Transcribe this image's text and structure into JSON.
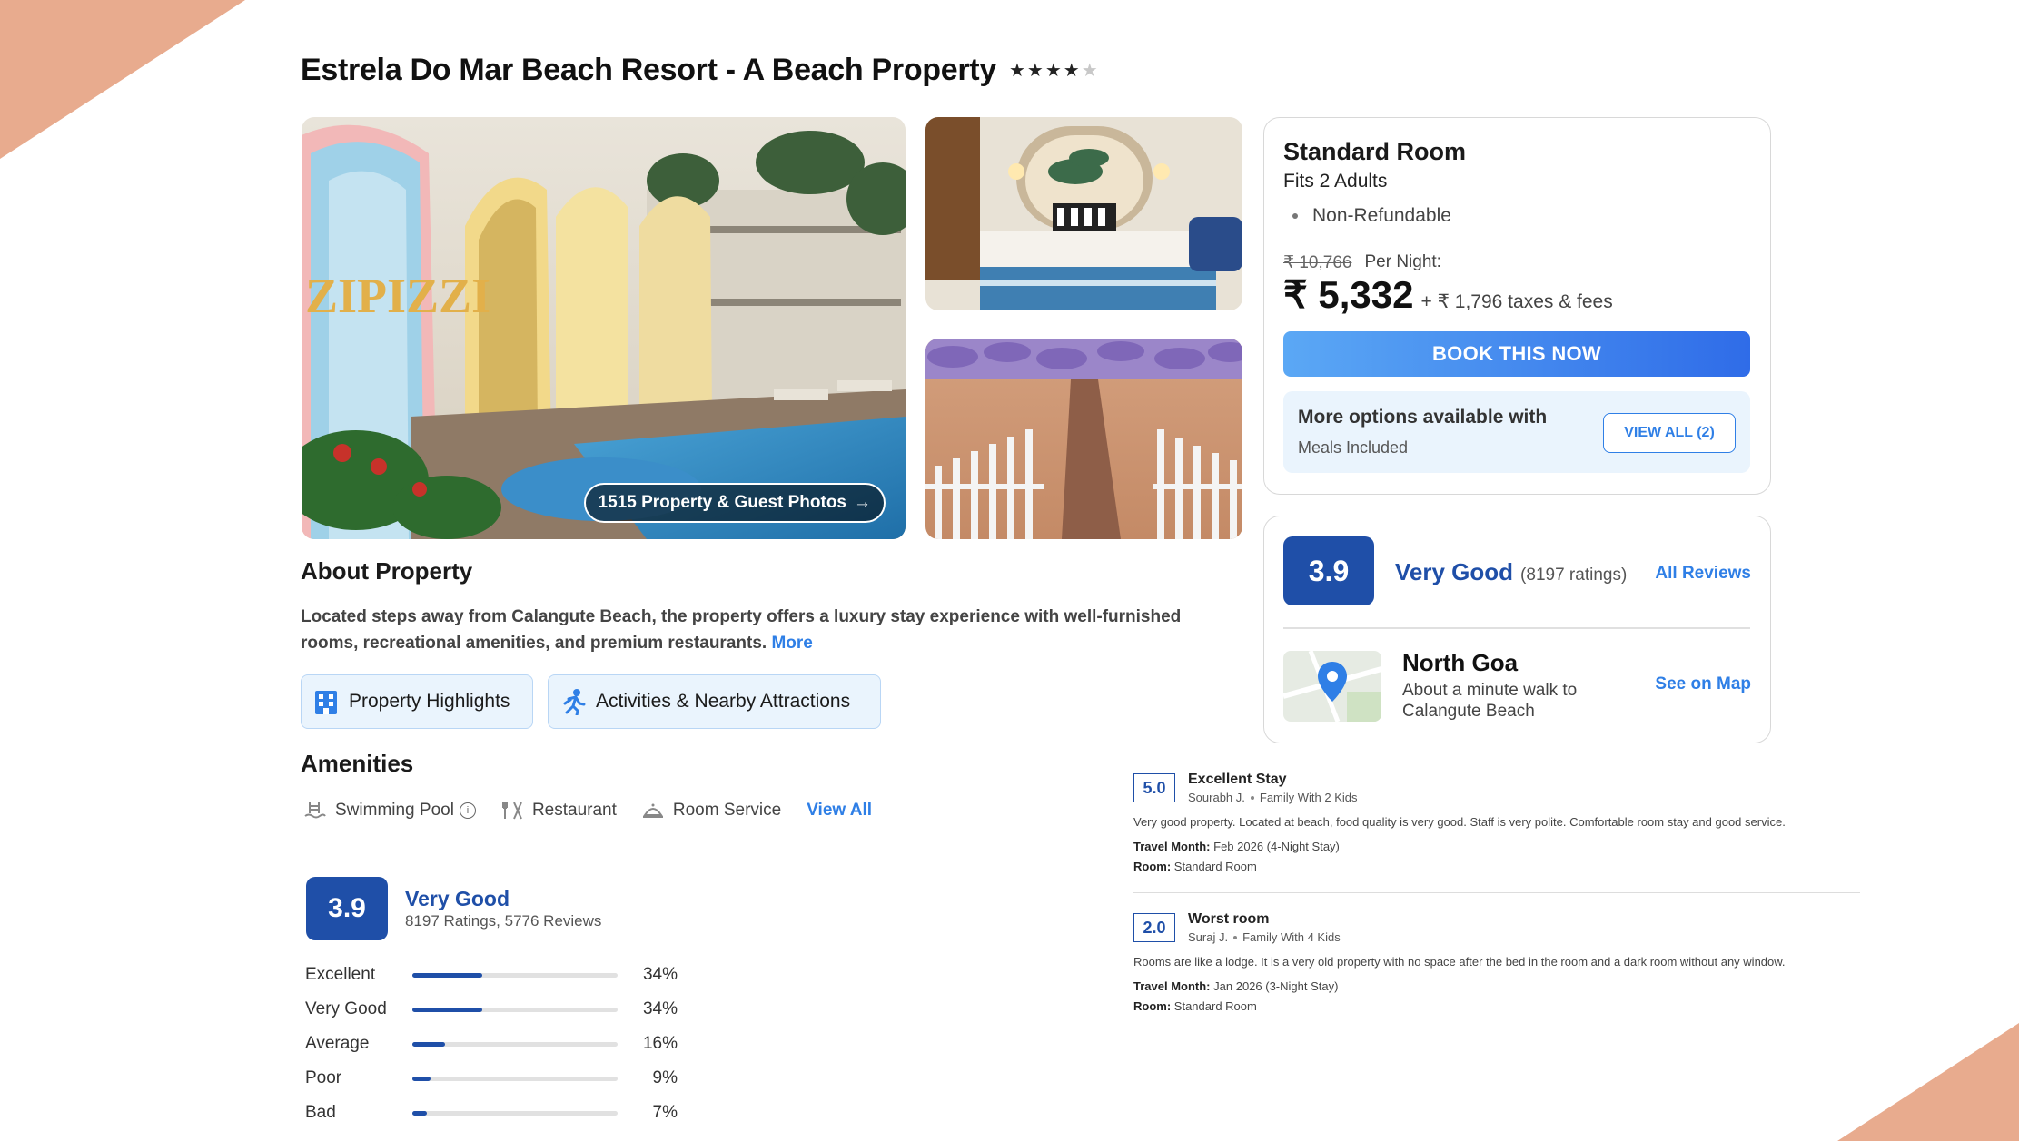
{
  "hotel": {
    "title": "Estrela Do Mar Beach Resort - A Beach Property",
    "star_rating": 4
  },
  "gallery": {
    "photos_button": "1515 Property & Guest Photos"
  },
  "about": {
    "heading": "About Property",
    "text": "Located steps away from Calangute Beach, the property offers a luxury stay experience with well-furnished rooms, recreational amenities, and premium restaurants.",
    "more_link": "More",
    "chips": [
      "Property Highlights",
      "Activities & Nearby Attractions"
    ]
  },
  "amenities": {
    "heading": "Amenities",
    "items": [
      {
        "label": "Swimming Pool",
        "icon": "pool-icon"
      },
      {
        "label": "Restaurant",
        "icon": "restaurant-icon"
      },
      {
        "label": "Room Service",
        "icon": "room-service-icon"
      }
    ],
    "view_all": "View All"
  },
  "rating_summary": {
    "score": "3.9",
    "label": "Very Good",
    "sub": "8197 Ratings, 5776 Reviews",
    "distribution": [
      {
        "label": "Excellent",
        "pct": 34,
        "pct_text": "34%"
      },
      {
        "label": "Very Good",
        "pct": 34,
        "pct_text": "34%"
      },
      {
        "label": "Average",
        "pct": 16,
        "pct_text": "16%"
      },
      {
        "label": "Poor",
        "pct": 9,
        "pct_text": "9%"
      },
      {
        "label": "Bad",
        "pct": 7,
        "pct_text": "7%"
      }
    ]
  },
  "room": {
    "name": "Standard Room",
    "fits": "Fits 2 Adults",
    "policy": "Non-Refundable",
    "original_price": "₹ 10,766",
    "per_night": "Per Night:",
    "price": "₹ 5,332",
    "taxes": "+ ₹ 1,796 taxes & fees",
    "book_button": "BOOK THIS NOW",
    "more_options": "More options available with",
    "more_options_sub": "Meals Included",
    "view_all_button": "VIEW ALL (2)"
  },
  "rating_card": {
    "score": "3.9",
    "label": "Very Good",
    "count": "(8197 ratings)",
    "all_reviews": "All Reviews"
  },
  "location": {
    "name": "North Goa",
    "desc": "About a minute walk to Calangute Beach",
    "see_map": "See on Map"
  },
  "reviews": [
    {
      "score": "5.0",
      "title": "Excellent Stay",
      "author": "Sourabh J.",
      "group": "Family With 2 Kids",
      "body": "Very good property. Located at beach, food quality is very good. Staff is very polite. Comfortable room stay and good service.",
      "travel_label": "Travel Month:",
      "travel": "Feb 2026 (4-Night Stay)",
      "room_label": "Room:",
      "room": "Standard Room"
    },
    {
      "score": "2.0",
      "title": "Worst room",
      "author": "Suraj J.",
      "group": "Family With 4 Kids",
      "body": "Rooms are like a lodge. It is a very old property with no space after the bed in the room and a dark room without any window.",
      "travel_label": "Travel Month:",
      "travel": "Jan 2026 (3-Night Stay)",
      "room_label": "Room:",
      "room": "Standard Room"
    }
  ],
  "colors": {
    "accent_blue": "#2f7fe6",
    "rating_blue": "#1f4fa8",
    "corner_peach": "#e8ab8e"
  }
}
